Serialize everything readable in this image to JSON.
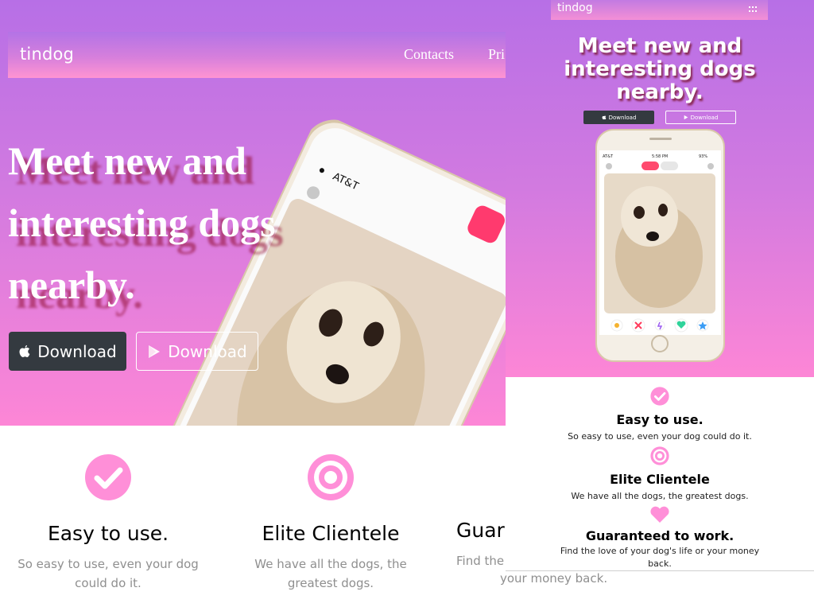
{
  "desktop": {
    "brand": "tindog",
    "nav": {
      "contacts": "Contacts",
      "pricing_partial": "Pri"
    },
    "heading_lines": [
      "Meet new and",
      "interesting dogs",
      "nearby."
    ],
    "download_apple": "Download",
    "download_google": "Download",
    "phone_carrier": "AT&T",
    "features": [
      {
        "title": "Easy to use.",
        "text": "So easy to use, even your dog could do it."
      },
      {
        "title": "Elite Clientele",
        "text": "We have all the dogs, the greatest dogs."
      },
      {
        "title_partial": "Guara",
        "text_partial": "Find the",
        "text_overflow": "your money back."
      }
    ]
  },
  "mobile": {
    "brand": "tindog",
    "heading_lines": [
      "Meet new and",
      "interesting dogs",
      "nearby."
    ],
    "download_apple": "Download",
    "download_google": "Download",
    "phone_status": {
      "carrier": "AT&T",
      "time": "5:58 PM",
      "battery": "93%"
    },
    "features": [
      {
        "title": "Easy to use.",
        "text": "So easy to use, even your dog could do it."
      },
      {
        "title": "Elite Clientele",
        "text": "We have all the dogs, the greatest dogs."
      },
      {
        "title": "Guaranteed to work.",
        "text": "Find the love of your dog's life or your money back."
      }
    ]
  },
  "colors": {
    "gradient_top": "#b76fe6",
    "gradient_bottom": "#fd86d6",
    "accent_pink": "#ff8fd8",
    "dark_button": "#343a40"
  },
  "icons": [
    "apple-icon",
    "google-play-icon",
    "check-circle-icon",
    "bullseye-icon",
    "heart-icon",
    "hamburger-icon"
  ]
}
